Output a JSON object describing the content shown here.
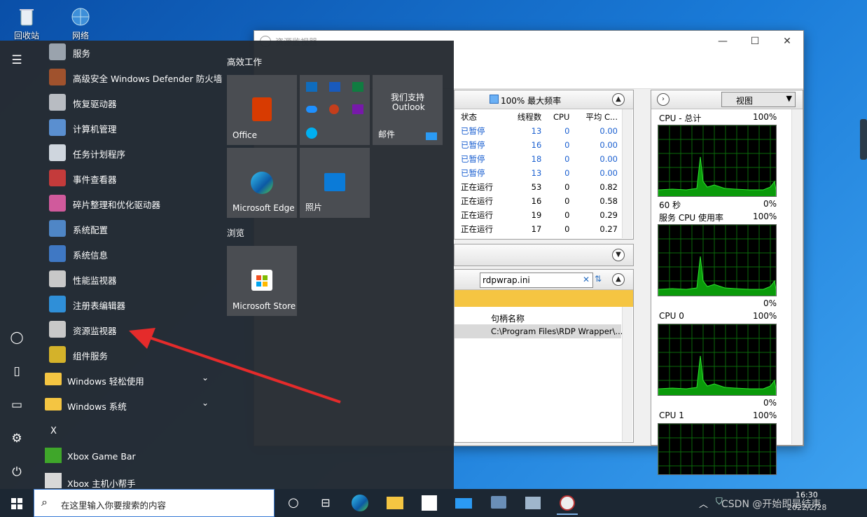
{
  "desktop": {
    "icons": [
      {
        "label": "回收站"
      },
      {
        "label": "网络"
      }
    ]
  },
  "resmon": {
    "title": "资源监视器",
    "cpu_header": "100% 最大频率",
    "columns": [
      "状态",
      "线程数",
      "CPU",
      "平均 C..."
    ],
    "rows": [
      {
        "status": "已暂停",
        "threads": "13",
        "cpu": "0",
        "avg": "0.00"
      },
      {
        "status": "已暂停",
        "threads": "16",
        "cpu": "0",
        "avg": "0.00"
      },
      {
        "status": "已暂停",
        "threads": "18",
        "cpu": "0",
        "avg": "0.00"
      },
      {
        "status": "已暂停",
        "threads": "13",
        "cpu": "0",
        "avg": "0.00"
      },
      {
        "status": "正在运行",
        "threads": "53",
        "cpu": "0",
        "avg": "0.82"
      },
      {
        "status": "正在运行",
        "threads": "16",
        "cpu": "0",
        "avg": "0.58"
      },
      {
        "status": "正在运行",
        "threads": "19",
        "cpu": "0",
        "avg": "0.29"
      },
      {
        "status": "正在运行",
        "threads": "17",
        "cpu": "0",
        "avg": "0.27"
      }
    ],
    "handle_search": "rdpwrap.ini",
    "handle_col": "句柄名称",
    "handle_row": "C:\\Program Files\\RDP Wrapper\\...",
    "view_label": "视图",
    "graphs": [
      {
        "title": "CPU - 总计",
        "max": "100%",
        "foot_left": "60 秒",
        "foot_right": "0%"
      },
      {
        "title": "服务 CPU 使用率",
        "max": "100%",
        "foot_left": "",
        "foot_right": "0%"
      },
      {
        "title": "CPU 0",
        "max": "100%",
        "foot_left": "",
        "foot_right": "0%"
      },
      {
        "title": "CPU 1",
        "max": "100%",
        "foot_left": "",
        "foot_right": ""
      }
    ]
  },
  "start": {
    "apps": [
      {
        "label": "服务",
        "icon": "gear-icon",
        "color": "#9aa3ad"
      },
      {
        "label": "高级安全 Windows Defender 防火墙",
        "icon": "firewall-icon",
        "color": "#a0522d"
      },
      {
        "label": "恢复驱动器",
        "icon": "drive-icon",
        "color": "#b8bcc2"
      },
      {
        "label": "计算机管理",
        "icon": "computer-management-icon",
        "color": "#5a8fd0"
      },
      {
        "label": "任务计划程序",
        "icon": "clock-icon",
        "color": "#cfd6de"
      },
      {
        "label": "事件查看器",
        "icon": "event-viewer-icon",
        "color": "#c43b3b"
      },
      {
        "label": "碎片整理和优化驱动器",
        "icon": "defrag-icon",
        "color": "#d05a9c"
      },
      {
        "label": "系统配置",
        "icon": "system-config-icon",
        "color": "#4f86c6"
      },
      {
        "label": "系统信息",
        "icon": "system-info-icon",
        "color": "#3f78c4"
      },
      {
        "label": "性能监视器",
        "icon": "performance-icon",
        "color": "#c8c8c8"
      },
      {
        "label": "注册表编辑器",
        "icon": "registry-icon",
        "color": "#2f8fd8"
      },
      {
        "label": "资源监视器",
        "icon": "resource-monitor-icon",
        "color": "#c8c8c8"
      },
      {
        "label": "组件服务",
        "icon": "component-services-icon",
        "color": "#d4b22a"
      }
    ],
    "folders": [
      {
        "label": "Windows 轻松使用"
      },
      {
        "label": "Windows 系统"
      }
    ],
    "letter": "X",
    "x_apps": [
      {
        "label": "Xbox Game Bar",
        "icon": "xbox-game-bar-icon"
      },
      {
        "label": "Xbox 主机小帮手",
        "icon": "xbox-companion-icon"
      }
    ],
    "group1": "高效工作",
    "group2": "浏览",
    "tiles": {
      "office": "Office",
      "mail_line1": "我们支持",
      "mail_line2": "Outlook",
      "mail": "邮件",
      "edge": "Microsoft Edge",
      "photos": "照片",
      "store": "Microsoft Store"
    }
  },
  "taskbar": {
    "search_placeholder": "在这里输入你要搜索的内容",
    "time": "16:30",
    "date": "2022/2/28",
    "watermark": "CSDN @开始即是结束"
  }
}
